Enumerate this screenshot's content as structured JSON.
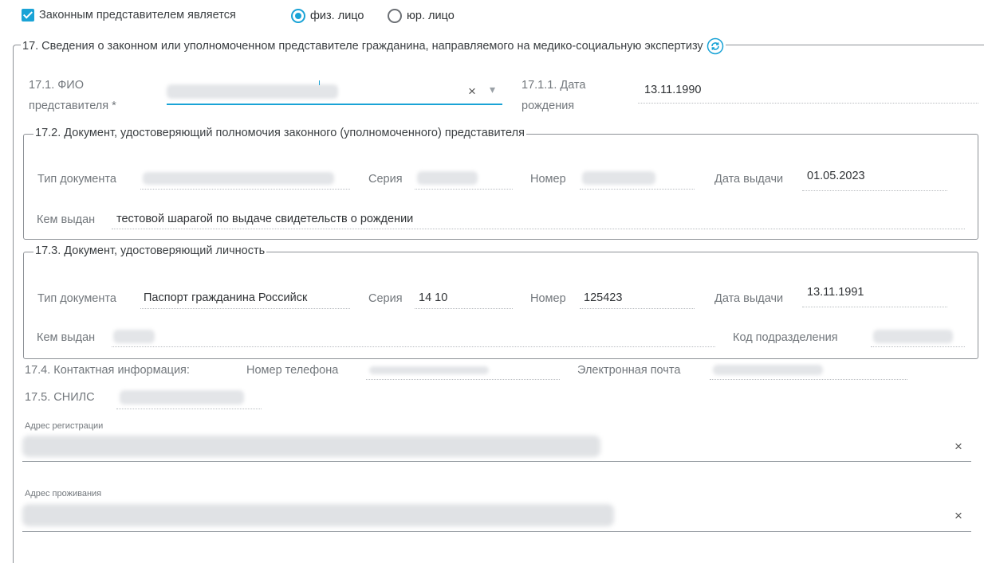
{
  "header": {
    "legal_rep_checkbox": "Законным представителем является",
    "radio_individual": "физ. лицо",
    "radio_legal": "юр. лицо"
  },
  "section17": {
    "title": "17. Сведения о законном или уполномоченном представителе гражданина, направляемого на медико-социальную экспертизу",
    "fio_label_1": "17.1. ФИО",
    "fio_label_2": "представителя *",
    "fio_value": "",
    "dob_label_1": "17.1.1. Дата",
    "dob_label_2": "рождения",
    "dob_value": "13.11.1990"
  },
  "section17_2": {
    "title": "17.2. Документ, удостоверяющий полномочия законного (уполномоченного) представителя",
    "doc_type_label": "Тип документа",
    "series_label": "Серия",
    "number_label": "Номер",
    "issue_date_label": "Дата выдачи",
    "issue_date_value": "01.05.2023",
    "issued_by_label": "Кем выдан",
    "issued_by_value": "тестовой шарагой по выдаче свидетельств о рождении"
  },
  "section17_3": {
    "title": "17.3. Документ, удостоверяющий личность",
    "doc_type_label": "Тип документа",
    "doc_type_value": "Паспорт гражданина Российск",
    "series_label": "Серия",
    "series_value": "14 10",
    "number_label": "Номер",
    "number_value": "125423",
    "issue_date_label": "Дата выдачи",
    "issue_date_value": "13.11.1991",
    "issued_by_label": "Кем выдан",
    "division_code_label": "Код подразделения"
  },
  "section17_4": {
    "label": "17.4. Контактная информация:",
    "phone_label": "Номер телефона",
    "email_label": "Электронная почта"
  },
  "section17_5": {
    "label": "17.5. СНИЛС"
  },
  "addresses": {
    "registration_label": "Адрес регистрации",
    "residence_label": "Адрес проживания"
  },
  "icons": {
    "clear": "×",
    "dropdown": "▾"
  },
  "colors": {
    "accent": "#1aa3d6",
    "border": "#8d9196"
  }
}
